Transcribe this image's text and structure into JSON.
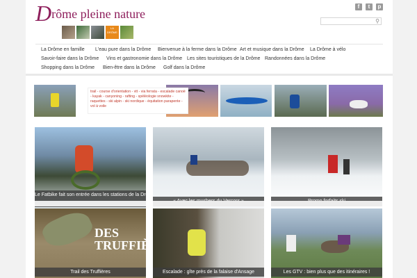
{
  "site": {
    "title_big": "D",
    "title_rest": "rôme pleine nature",
    "badge": "LA DRÔME"
  },
  "social": [
    "f",
    "t",
    "p"
  ],
  "search": {
    "icon": "search-icon"
  },
  "nav": [
    "La Drôme en famille",
    "L'eau pure dans la Drôme",
    "Bienvenue à la ferme dans la Drôme",
    "Art et musique dans la Drôme",
    "La Drôme à vélo",
    "Savoir-faire dans la Drôme",
    "Vins et gastronomie dans la Drôme",
    "Les sites touristiques de la Drôme",
    "Randonnées dans la Drôme",
    "Shopping dans la Drôme",
    "Bien-être dans la Drôme",
    "Golf dans la Drôme"
  ],
  "activities": "trail - course d'orientation - vtt - via ferrata - escalade canoë - kayak - canyoning - rafting - spéléologie snowkite - raquettes - ski alpin - ski nordique - équitation parapente - vol à voile",
  "tiles": [
    {
      "caption": "Le Fatbike fait son entrée dans les stations de la Drôme !"
    },
    {
      "caption": "« Avec les mushers du Vercors »"
    },
    {
      "caption": "Promo forfaits ski"
    },
    {
      "caption": "Trail des Truffières"
    },
    {
      "caption": "Escalade : gîte près de la falaise d'Ansage"
    },
    {
      "caption": "Les GTV : bien plus que des itinéraires !"
    }
  ],
  "colors": {
    "brand": "#8e1f5c",
    "accent": "#e8891a",
    "activity_text": "#c0392b"
  }
}
